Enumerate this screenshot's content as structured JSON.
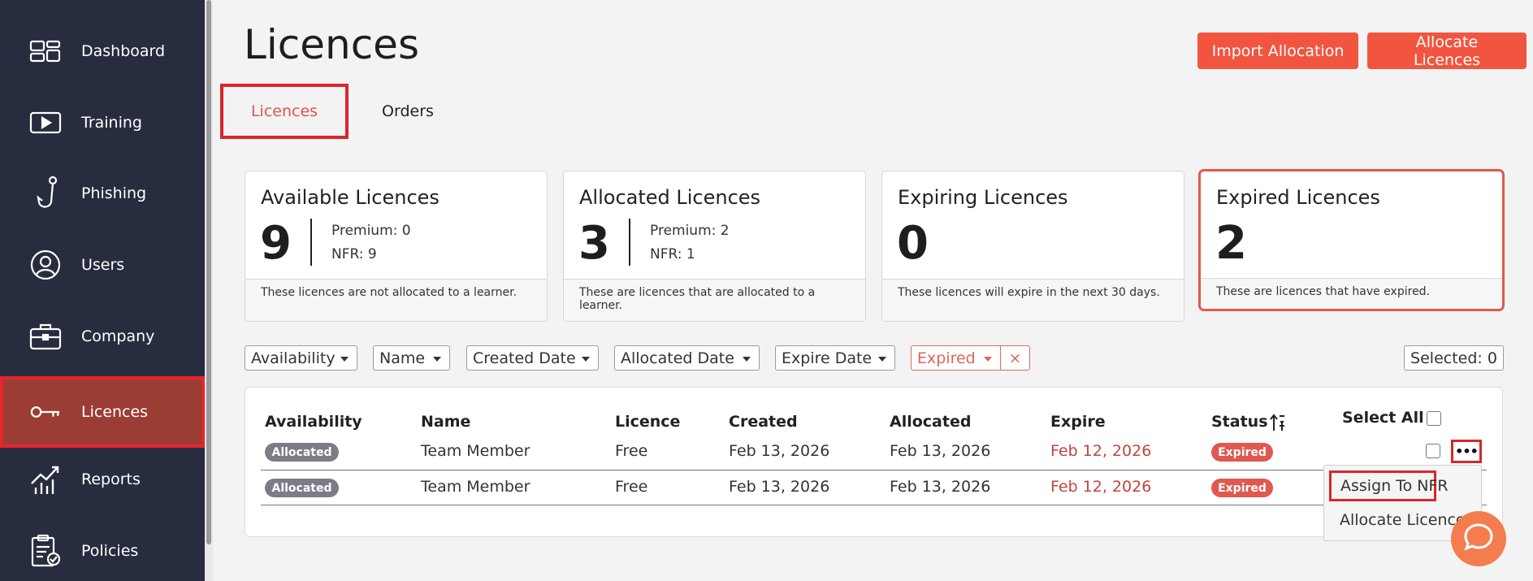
{
  "sidebar": {
    "items": [
      {
        "label": "Dashboard",
        "icon": "dashboard-icon"
      },
      {
        "label": "Training",
        "icon": "play-icon"
      },
      {
        "label": "Phishing",
        "icon": "hook-icon"
      },
      {
        "label": "Users",
        "icon": "user-icon"
      },
      {
        "label": "Company",
        "icon": "briefcase-icon"
      },
      {
        "label": "Licences",
        "icon": "key-icon",
        "active": true
      },
      {
        "label": "Reports",
        "icon": "chart-icon"
      },
      {
        "label": "Policies",
        "icon": "clipboard-icon"
      }
    ]
  },
  "header": {
    "title": "Licences",
    "import_label": "Import Allocation",
    "allocate_label": "Allocate Licences"
  },
  "tabs": [
    {
      "label": "Licences",
      "active": true
    },
    {
      "label": "Orders",
      "active": false
    }
  ],
  "cards": {
    "available": {
      "title": "Available Licences",
      "value": "9",
      "premium": "Premium: 0",
      "nfr": "NFR: 9",
      "description": "These licences are not allocated to a learner."
    },
    "allocated": {
      "title": "Allocated Licences",
      "value": "3",
      "premium": "Premium: 2",
      "nfr": "NFR: 1",
      "description": "These are licences that are allocated to a learner."
    },
    "expiring": {
      "title": "Expiring Licences",
      "value": "0",
      "description": "These licences will expire in the next 30 days."
    },
    "expired": {
      "title": "Expired Licences",
      "value": "2",
      "description": "These are licences that have expired."
    }
  },
  "filters": {
    "availability": "Availability",
    "name": "Name",
    "created": "Created Date",
    "allocated": "Allocated Date",
    "expire": "Expire Date",
    "status": "Expired",
    "clear": "×",
    "selected": "Selected: 0"
  },
  "table": {
    "headers": {
      "availability": "Availability",
      "name": "Name",
      "licence": "Licence",
      "created": "Created",
      "allocated": "Allocated",
      "expire": "Expire",
      "status": "Status",
      "select_all": "Select All"
    },
    "sort_icon": "sort-ascending-icon",
    "rows": [
      {
        "availability": "Allocated",
        "name": "Team Member",
        "licence": "Free",
        "created": "Feb 13, 2026",
        "allocated": "Feb 13, 2026",
        "expire": "Feb 12, 2026",
        "status": "Expired"
      },
      {
        "availability": "Allocated",
        "name": "Team Member",
        "licence": "Free",
        "created": "Feb 13, 2026",
        "allocated": "Feb 13, 2026",
        "expire": "Feb 12, 2026",
        "status": "Expired"
      }
    ]
  },
  "row_menu": {
    "more": "•••",
    "items": [
      "Assign To NFR",
      "Allocate Licence"
    ]
  },
  "colors": {
    "sidebar_bg": "#272d3e",
    "accent": "#f2553f",
    "active_nav": "#9b3d35",
    "expired_red": "#c0453f",
    "help_button": "#f47d50"
  }
}
